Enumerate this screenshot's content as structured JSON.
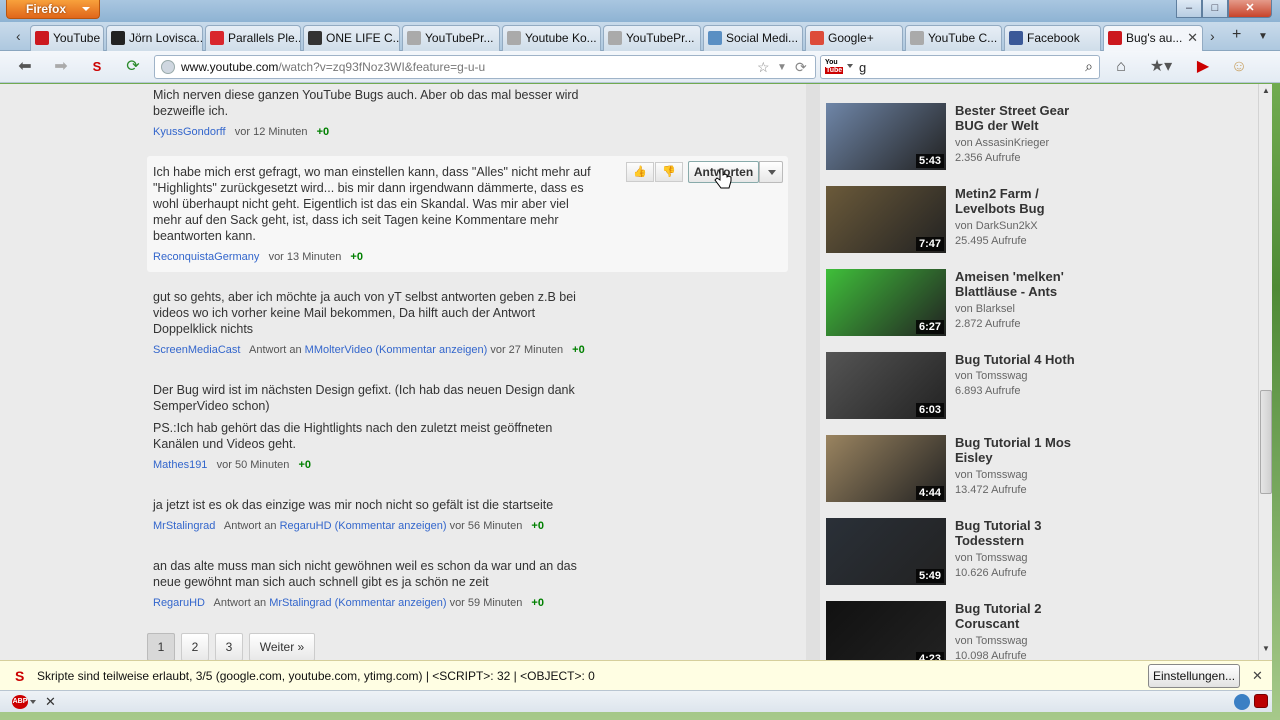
{
  "browser": {
    "app_button": "Firefox",
    "tabs": [
      {
        "label": "YouTube Cr...",
        "icon": "youtube-icon",
        "color": "#cc181e"
      },
      {
        "label": "Jörn Lovisca...",
        "icon": "jl-icon",
        "color": "#222222"
      },
      {
        "label": "Parallels Ple...",
        "icon": "parallels-icon",
        "color": "#d9262c"
      },
      {
        "label": "ONE LIFE C...",
        "icon": "onelife-icon",
        "color": "#333333"
      },
      {
        "label": "YouTubePr...",
        "icon": "page-icon",
        "color": "#aaaaaa"
      },
      {
        "label": "Youtube Ko...",
        "icon": "page-icon",
        "color": "#aaaaaa"
      },
      {
        "label": "YouTubePr...",
        "icon": "page-icon",
        "color": "#aaaaaa"
      },
      {
        "label": "Social Medi...",
        "icon": "globe-icon",
        "color": "#5a8fc3"
      },
      {
        "label": "Google+",
        "icon": "google-plus-icon",
        "color": "#dd4b39"
      },
      {
        "label": "YouTube C...",
        "icon": "page-icon",
        "color": "#aaaaaa"
      },
      {
        "label": "Facebook",
        "icon": "facebook-icon",
        "color": "#3b5998"
      },
      {
        "label": "Bug's au...",
        "icon": "youtube-icon",
        "color": "#cc181e"
      }
    ],
    "url_host": "www.youtube.com",
    "url_path": "/watch?v=zq93fNoz3WI&feature=g-u-u",
    "search_value": "g"
  },
  "comments": [
    {
      "text": "Mich nerven diese ganzen YouTube Bugs auch. Aber ob das mal besser wird bezweifle ich.",
      "user": "KyussGondorff",
      "reply_prefix": "",
      "reply_to": "",
      "reply_link": "",
      "time": "vor 12 Minuten",
      "score": "+0"
    },
    {
      "text": "Ich habe mich erst gefragt, wo man einstellen kann, dass \"Alles\" nicht mehr auf \"Highlights\" zurückgesetzt wird... bis mir dann irgendwann dämmerte, dass es wohl überhaupt nicht geht. Eigentlich ist das ein Skandal. Was mir aber viel mehr auf den Sack geht, ist, dass ich seit Tagen keine Kommentare mehr beantworten kann.",
      "user": "ReconquistaGermany",
      "reply_prefix": "",
      "reply_to": "",
      "reply_link": "",
      "time": "vor 13 Minuten",
      "score": "+0"
    },
    {
      "text": "gut so gehts, aber ich möchte ja auch von yT selbst antworten geben z.B bei videos wo ich vorher keine Mail bekommen, Da hilft auch der Antwort Doppelklick nichts",
      "user": "ScreenMediaCast",
      "reply_prefix": "Antwort an",
      "reply_to": "MMolterVideo",
      "reply_link": "(Kommentar anzeigen)",
      "time": "vor 27 Minuten",
      "score": "+0"
    },
    {
      "text": "Der Bug wird ist im nächsten Design gefixt. (Ich hab das neuen Design dank SemperVideo schon)",
      "text2": "PS.:Ich hab gehört das die Hightlights nach den zuletzt meist geöffneten Kanälen und Videos geht.",
      "user": "Mathes191",
      "reply_prefix": "",
      "reply_to": "",
      "reply_link": "",
      "time": "vor 50 Minuten",
      "score": "+0"
    },
    {
      "text": "ja jetzt ist es ok das einzige was mir noch nicht so gefält ist die startseite",
      "user": "MrStalingrad",
      "reply_prefix": "Antwort an",
      "reply_to": "RegaruHD",
      "reply_link": "(Kommentar anzeigen)",
      "time": "vor 56 Minuten",
      "score": "+0"
    },
    {
      "text": "an das alte muss man sich nicht gewöhnen weil es schon da war und an das neue gewöhnt man sich auch schnell gibt es ja schön ne zeit",
      "user": "RegaruHD",
      "reply_prefix": "Antwort an",
      "reply_to": "MrStalingrad",
      "reply_link": "(Kommentar anzeigen)",
      "time": "vor 59 Minuten",
      "score": "+0"
    }
  ],
  "reply_button": "Antworten",
  "pagination": {
    "pages": [
      "1",
      "2",
      "3"
    ],
    "next": "Weiter »",
    "current": "1"
  },
  "related_videos": [
    {
      "title": "Bester Street Gear BUG der Welt",
      "by": "von AssasinKrieger",
      "views": "2.356 Aufrufe",
      "duration": "5:43",
      "thumb_color": "#6f86a8"
    },
    {
      "title": "Metin2 Farm / Levelbots Bug",
      "by": "von DarkSun2kX",
      "views": "25.495 Aufrufe",
      "duration": "7:47",
      "thumb_color": "#6b5a3a"
    },
    {
      "title": "Ameisen 'melken' Blattläuse - Ants",
      "by": "von Blarksel",
      "views": "2.872 Aufrufe",
      "duration": "6:27",
      "thumb_color": "#3fbf3a"
    },
    {
      "title": "Bug Tutorial 4 Hoth",
      "by": "von Tomsswag",
      "views": "6.893 Aufrufe",
      "duration": "6:03",
      "thumb_color": "#555555"
    },
    {
      "title": "Bug Tutorial 1 Mos Eisley",
      "by": "von Tomsswag",
      "views": "13.472 Aufrufe",
      "duration": "4:44",
      "thumb_color": "#9a8460"
    },
    {
      "title": "Bug Tutorial 3 Todesstern",
      "by": "von Tomsswag",
      "views": "10.626 Aufrufe",
      "duration": "5:49",
      "thumb_color": "#2a3038"
    },
    {
      "title": "Bug Tutorial 2 Coruscant",
      "by": "von Tomsswag",
      "views": "10.098 Aufrufe",
      "duration": "4:23",
      "thumb_color": "#111111"
    }
  ],
  "notification": {
    "text": "Skripte sind teilweise erlaubt, 3/5 (google.com, youtube.com, ytimg.com) | <SCRIPT>: 32 | <OBJECT>: 0",
    "button": "Einstellungen..."
  }
}
